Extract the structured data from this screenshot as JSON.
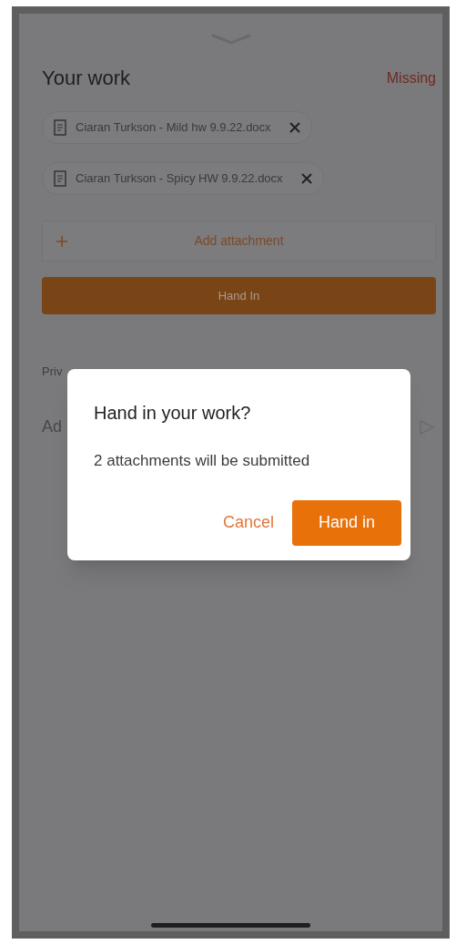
{
  "section": {
    "title": "Your work",
    "status": "Missing"
  },
  "attachments": [
    {
      "name": "Ciaran Turkson - Mild hw 9.9.22.docx"
    },
    {
      "name": "Ciaran Turkson - Spicy HW 9.9.22.docx"
    }
  ],
  "add_attachment": "Add attachment",
  "hand_in_button": "Hand In",
  "private_comments": {
    "label": "Priv",
    "input_placeholder": "Ad"
  },
  "dialog": {
    "title": "Hand in your work?",
    "message": "2 attachments will be submitted",
    "buttons": [
      {
        "label": "Cancel",
        "kind": "text"
      },
      {
        "label": "Hand in",
        "kind": "filled"
      }
    ]
  }
}
